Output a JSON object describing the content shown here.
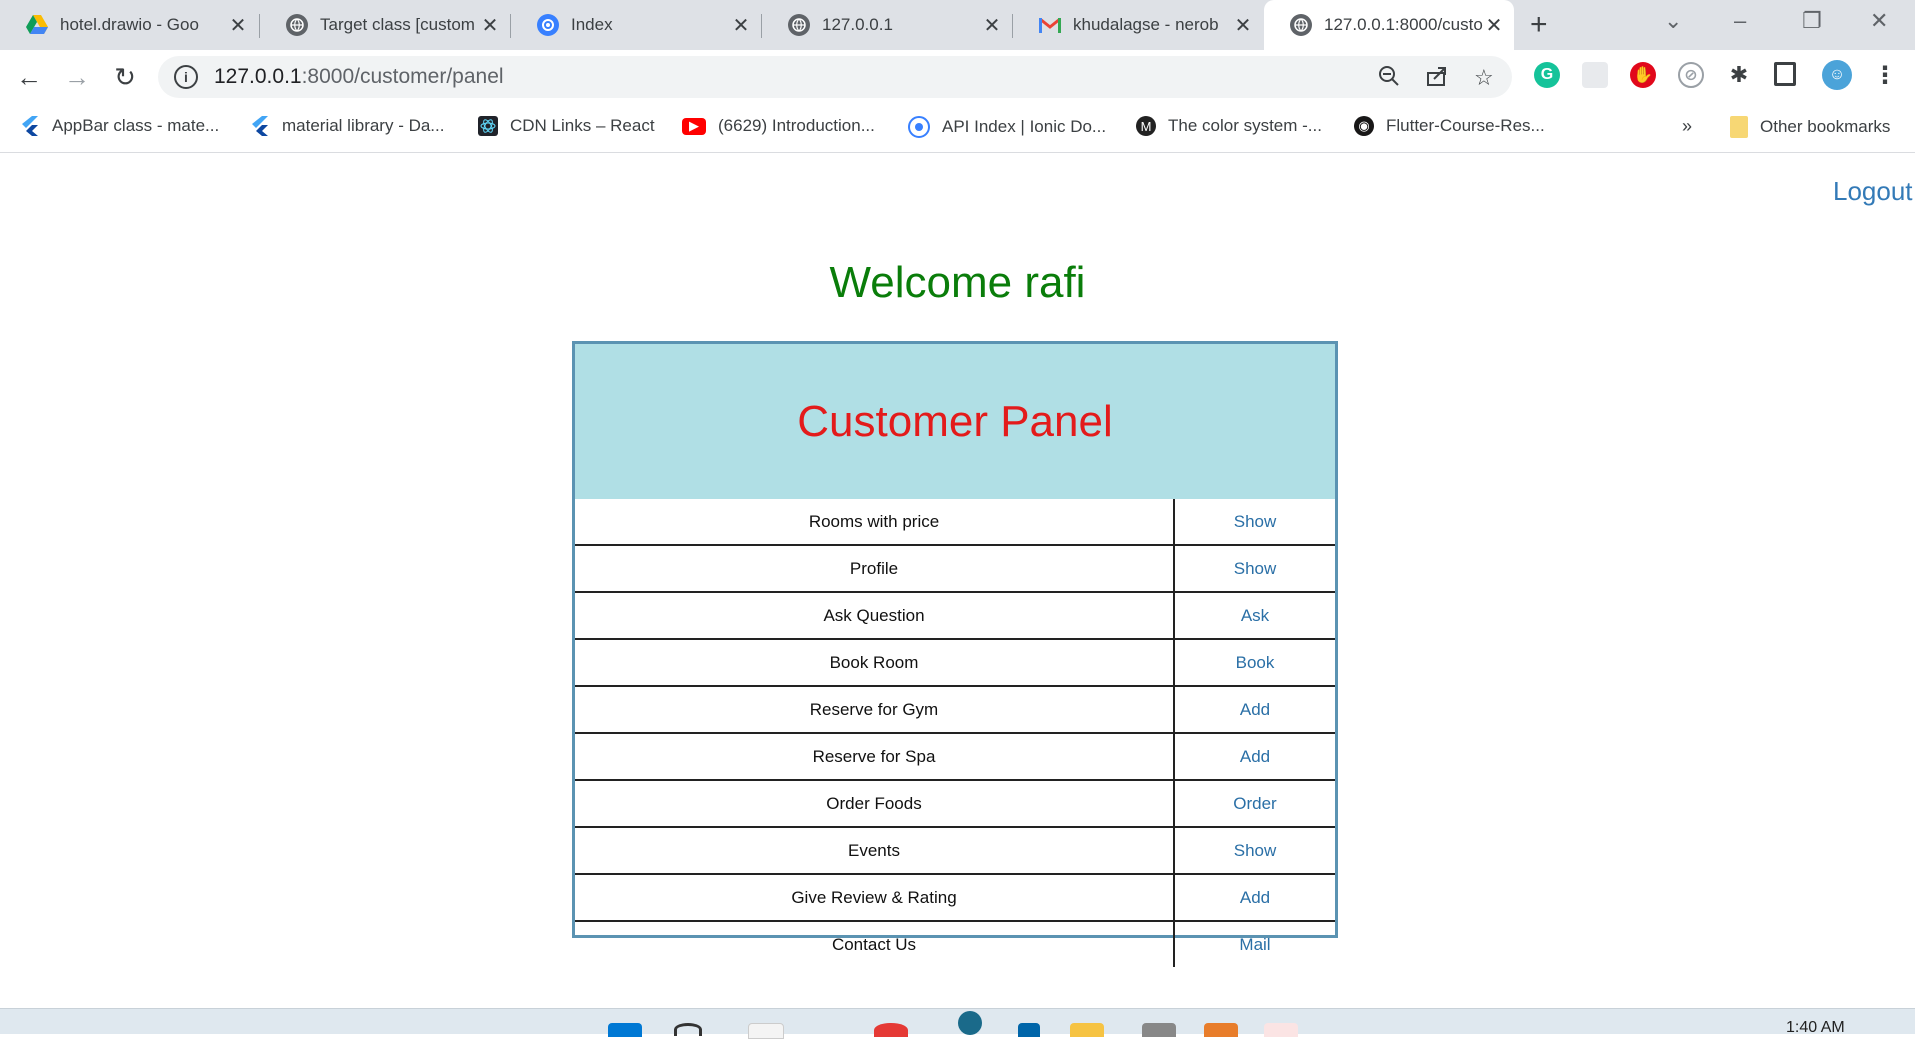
{
  "browser": {
    "tabs": [
      {
        "title": "hotel.drawio - Goo",
        "icon": "google-drive-icon"
      },
      {
        "title": "Target class [custom",
        "icon": "globe-icon"
      },
      {
        "title": "Index",
        "icon": "ionic-icon"
      },
      {
        "title": "127.0.0.1",
        "icon": "globe-icon"
      },
      {
        "title": "khudalagse - nerob",
        "icon": "gmail-icon"
      },
      {
        "title": "127.0.0.1:8000/custo",
        "icon": "globe-icon",
        "active": true
      }
    ],
    "new_tab": "+",
    "address": {
      "host": "127.0.0.1",
      "path": ":8000/customer/panel"
    },
    "bookmarks": [
      {
        "title": "AppBar class - mate...",
        "icon": "flutter-icon"
      },
      {
        "title": "material library - Da...",
        "icon": "flutter-icon"
      },
      {
        "title": "CDN Links – React",
        "icon": "react-icon"
      },
      {
        "title": "(6629) Introduction...",
        "icon": "youtube-icon"
      },
      {
        "title": "API Index | Ionic Do...",
        "icon": "ionic-icon"
      },
      {
        "title": "The color system -...",
        "icon": "material-icon"
      },
      {
        "title": "Flutter-Course-Res...",
        "icon": "github-icon"
      }
    ],
    "bookmarks_overflow": "»",
    "other_bookmarks": "Other bookmarks"
  },
  "page": {
    "logout": "Logout",
    "welcome": "Welcome rafi",
    "panel_title": "Customer Panel",
    "rows": [
      {
        "label": "Rooms with price",
        "action": "Show"
      },
      {
        "label": "Profile",
        "action": "Show"
      },
      {
        "label": "Ask Question",
        "action": "Ask"
      },
      {
        "label": "Book Room",
        "action": "Book"
      },
      {
        "label": "Reserve for Gym",
        "action": "Add"
      },
      {
        "label": "Reserve for Spa",
        "action": "Add"
      },
      {
        "label": "Order Foods",
        "action": "Order"
      },
      {
        "label": "Events",
        "action": "Show"
      },
      {
        "label": "Give Review & Rating",
        "action": "Add"
      },
      {
        "label": "Contact Us",
        "action": "Mail"
      }
    ]
  },
  "taskbar": {
    "time": "1:40 AM"
  },
  "colors": {
    "welcome": "#0a7d0a",
    "panel_title": "#e31b1b",
    "panel_header_bg": "#b0dfe5",
    "link": "#2a6fa6"
  }
}
